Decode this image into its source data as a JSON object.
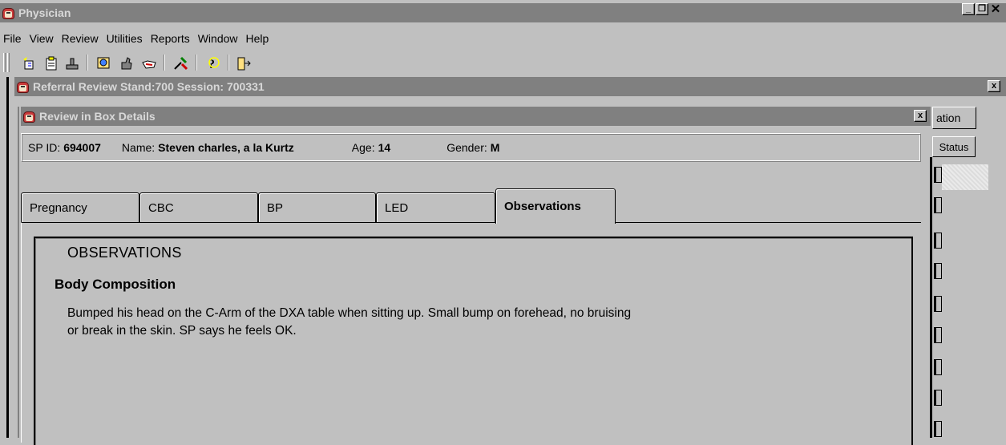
{
  "app": {
    "title": "Physician",
    "controls": [
      "_",
      "B",
      "x"
    ]
  },
  "menu": [
    "File",
    "View",
    "Review",
    "Utilities",
    "Reports",
    "Window",
    "Help"
  ],
  "toolbar": {
    "icons": [
      "new-icon",
      "clipboard-icon",
      "stamp-icon",
      "search-icon",
      "thumb-icon",
      "hand-icon",
      "tools-icon",
      "help-icon",
      "exit-icon"
    ]
  },
  "referral_window": {
    "title": "Referral Review Stand:700 Session: 700331",
    "close": "x"
  },
  "details_window": {
    "title": "Review in Box Details",
    "close": "x"
  },
  "right_panel": {
    "header_partial": "ation",
    "status_header": "Status"
  },
  "info": {
    "spid_label": "SP ID:",
    "spid_value": "694007",
    "name_label": "Name:",
    "name_value": "Steven charles, a la Kurtz",
    "age_label": "Age:",
    "age_value": "14",
    "gender_label": "Gender:",
    "gender_value": "M"
  },
  "tabs": [
    "Pregnancy",
    "CBC",
    "BP",
    "LED",
    "Observations"
  ],
  "active_tab": "Observations",
  "observations": {
    "heading": "OBSERVATIONS",
    "section": "Body Composition",
    "line1": "Bumped his head on the C-Arm of the DXA table when sitting up.  Small bump on forehead, no bruising",
    "line2": "or break in the skin.  SP says he feels OK."
  }
}
